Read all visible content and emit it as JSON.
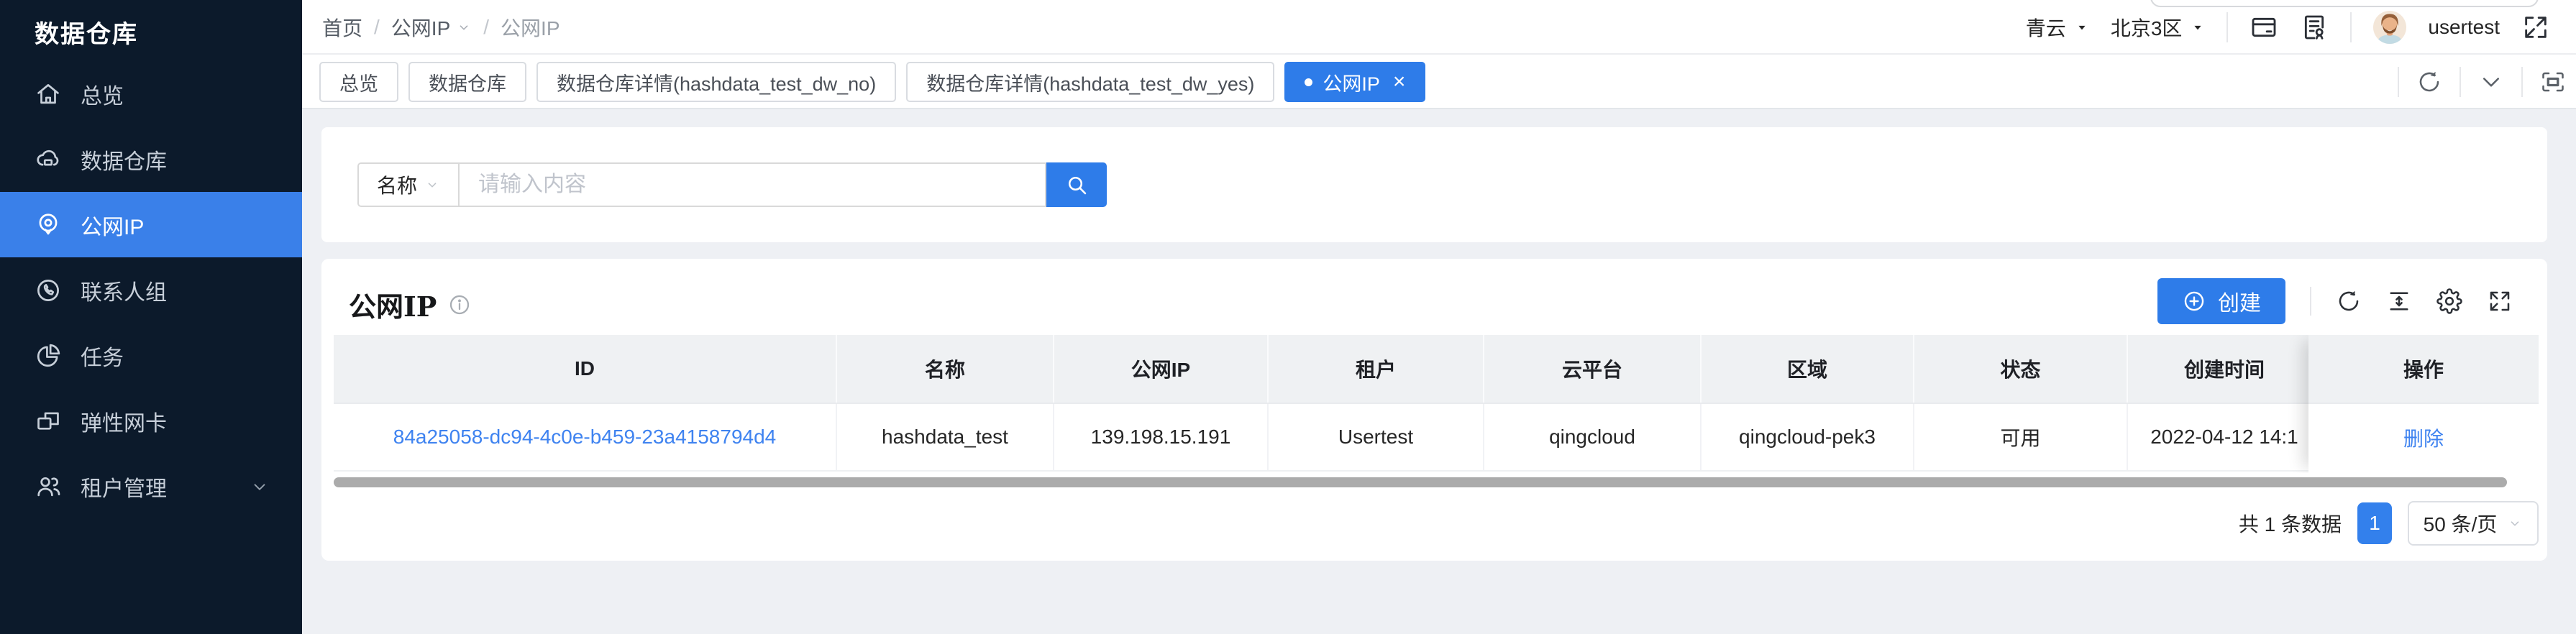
{
  "app": {
    "title": "数据仓库"
  },
  "sidebar": {
    "items": [
      {
        "label": "总览",
        "icon": "home-icon",
        "active": false
      },
      {
        "label": "数据仓库",
        "icon": "warehouse-cloud-icon",
        "active": false
      },
      {
        "label": "公网IP",
        "icon": "location-pin-icon",
        "active": true
      },
      {
        "label": "联系人组",
        "icon": "contact-phone-icon",
        "active": false
      },
      {
        "label": "任务",
        "icon": "pie-chart-icon",
        "active": false
      },
      {
        "label": "弹性网卡",
        "icon": "nic-card-icon",
        "active": false
      },
      {
        "label": "租户管理",
        "icon": "tenants-people-icon",
        "active": false,
        "expandable": true
      }
    ]
  },
  "breadcrumb": {
    "items": [
      "首页",
      "公网IP",
      "公网IP"
    ],
    "separator": "/"
  },
  "topbar": {
    "org": "青云",
    "region": "北京3区",
    "username": "usertest"
  },
  "tabbar": {
    "tabs": [
      {
        "label": "总览"
      },
      {
        "label": "数据仓库"
      },
      {
        "label": "数据仓库详情(hashdata_test_dw_no)"
      },
      {
        "label": "数据仓库详情(hashdata_test_dw_yes)"
      },
      {
        "label": "公网IP",
        "active": true,
        "close_label": "×"
      }
    ]
  },
  "search": {
    "field_label": "名称",
    "placeholder": "请输入内容"
  },
  "panel": {
    "title": "公网IP",
    "create_label": "创建"
  },
  "table": {
    "columns": [
      "ID",
      "名称",
      "公网IP",
      "租户",
      "云平台",
      "区域",
      "状态",
      "创建时间",
      "操作"
    ],
    "rows": [
      {
        "id": "84a25058-dc94-4c0e-b459-23a4158794d4",
        "name": "hashdata_test",
        "public_ip": "139.198.15.191",
        "tenant": "Usertest",
        "platform": "qingcloud",
        "zone": "qingcloud-pek3",
        "status": "可用",
        "created": "2022-04-12 14:1",
        "action": "删除"
      }
    ]
  },
  "pagination": {
    "total_text": "共 1 条数据",
    "page": "1",
    "page_size": "50 条/页"
  },
  "colors": {
    "accent": "#2e7ce9",
    "sidebar_active": "#3a80e9",
    "link": "#3f83f0",
    "sidebar_bg": "#0c1a2b",
    "content_bg": "#eef0f4"
  }
}
